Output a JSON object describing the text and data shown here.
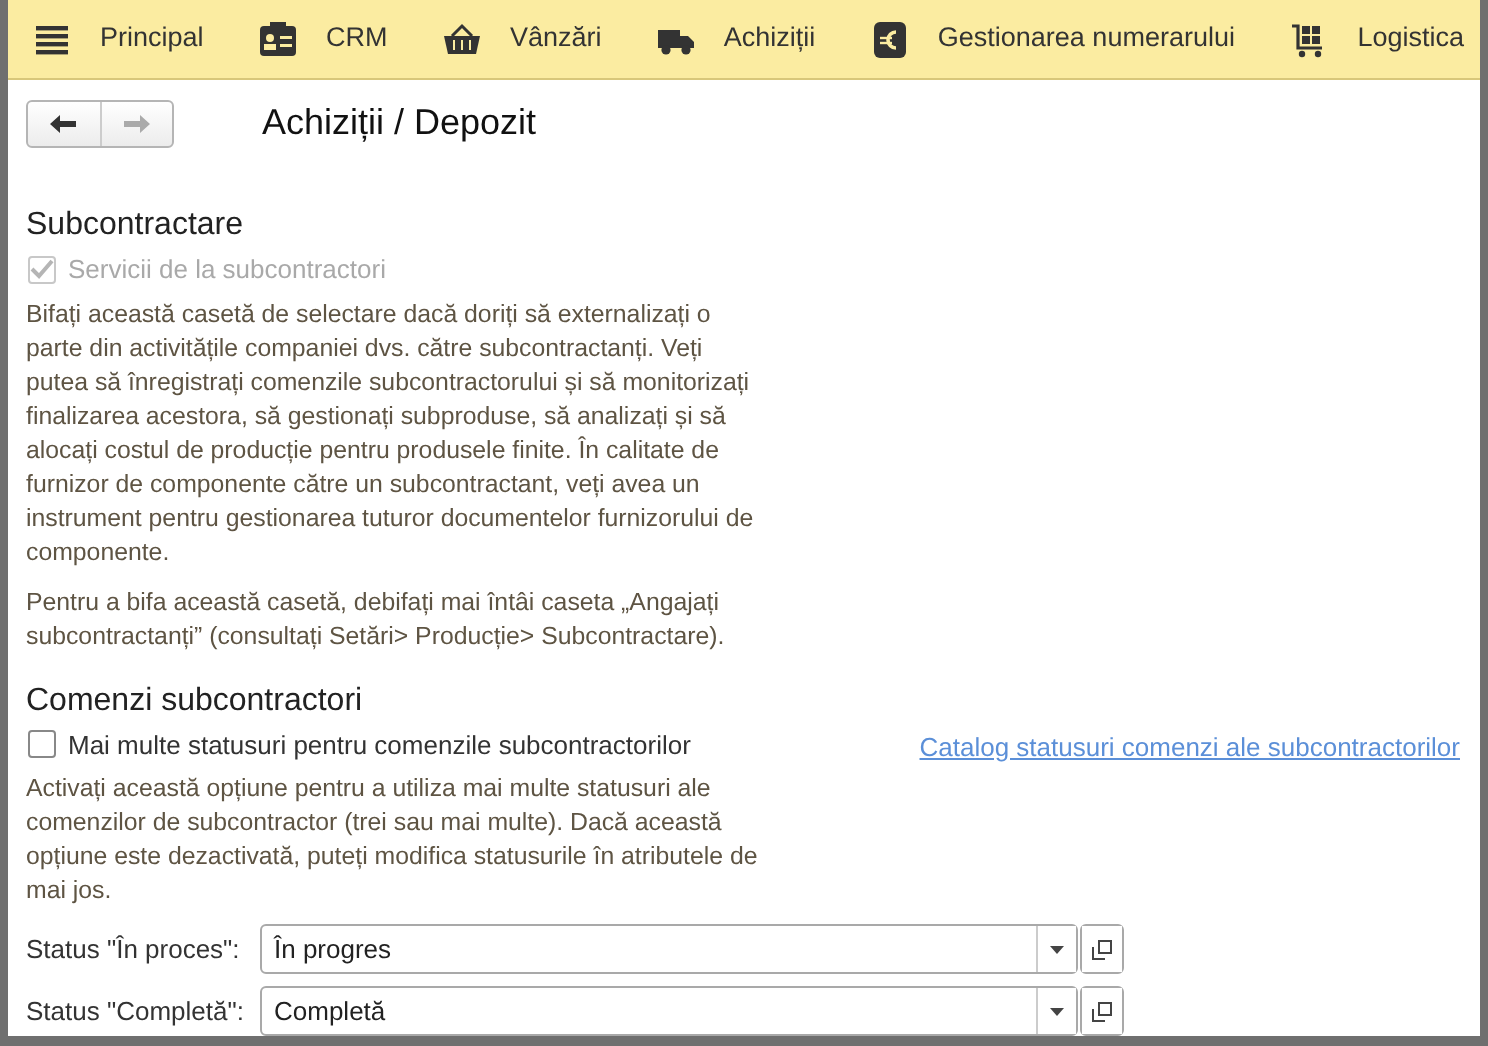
{
  "menu": [
    {
      "label": "Principal"
    },
    {
      "label": "CRM"
    },
    {
      "label": "Vânzări"
    },
    {
      "label": "Achiziții"
    },
    {
      "label": "Gestionarea numerarului"
    },
    {
      "label": "Logistica"
    }
  ],
  "navigation": {
    "back_disabled": false,
    "forward_disabled": true
  },
  "title": "Achiziții / Depozit",
  "sections": [
    {
      "heading": "Subcontractare",
      "checkbox": {
        "label": "Servicii de la subcontractori",
        "checked": true,
        "disabled": true
      },
      "paragraphs": [
        "Bifați această casetă de selectare dacă doriți să externalizați o parte din activitățile companiei dvs. către subcontractanți. Veți putea să înregistrați comenzile subcontractorului și să monitorizați finalizarea acestora, să gestionați subproduse, să analizați și să alocați costul de producție pentru produsele finite. În calitate de furnizor de componente către un subcontractant, veți avea un instrument pentru gestionarea tuturor documentelor furnizorului de componente.",
        "Pentru a bifa această casetă, debifați mai întâi caseta „Angajați subcontractanți” (consultați Setări> Producție> Subcontractare)."
      ]
    },
    {
      "heading": "Comenzi subcontractori",
      "checkbox": {
        "label": "Mai multe statusuri pentru comenzile subcontractorilor",
        "checked": false,
        "disabled": false
      },
      "link": "Catalog statusuri comenzi ale subcontractorilor",
      "paragraphs": [
        "Activați această opțiune pentru a utiliza mai multe statusuri ale comenzilor de subcontractor (trei sau mai multe). Dacă această opțiune este dezactivată, puteți modifica statusurile în atributele de mai jos."
      ],
      "fields": [
        {
          "label": "Status \"În proces\":",
          "value": "În progres"
        },
        {
          "label": "Status \"Completă\":",
          "value": "Completă"
        }
      ]
    }
  ]
}
